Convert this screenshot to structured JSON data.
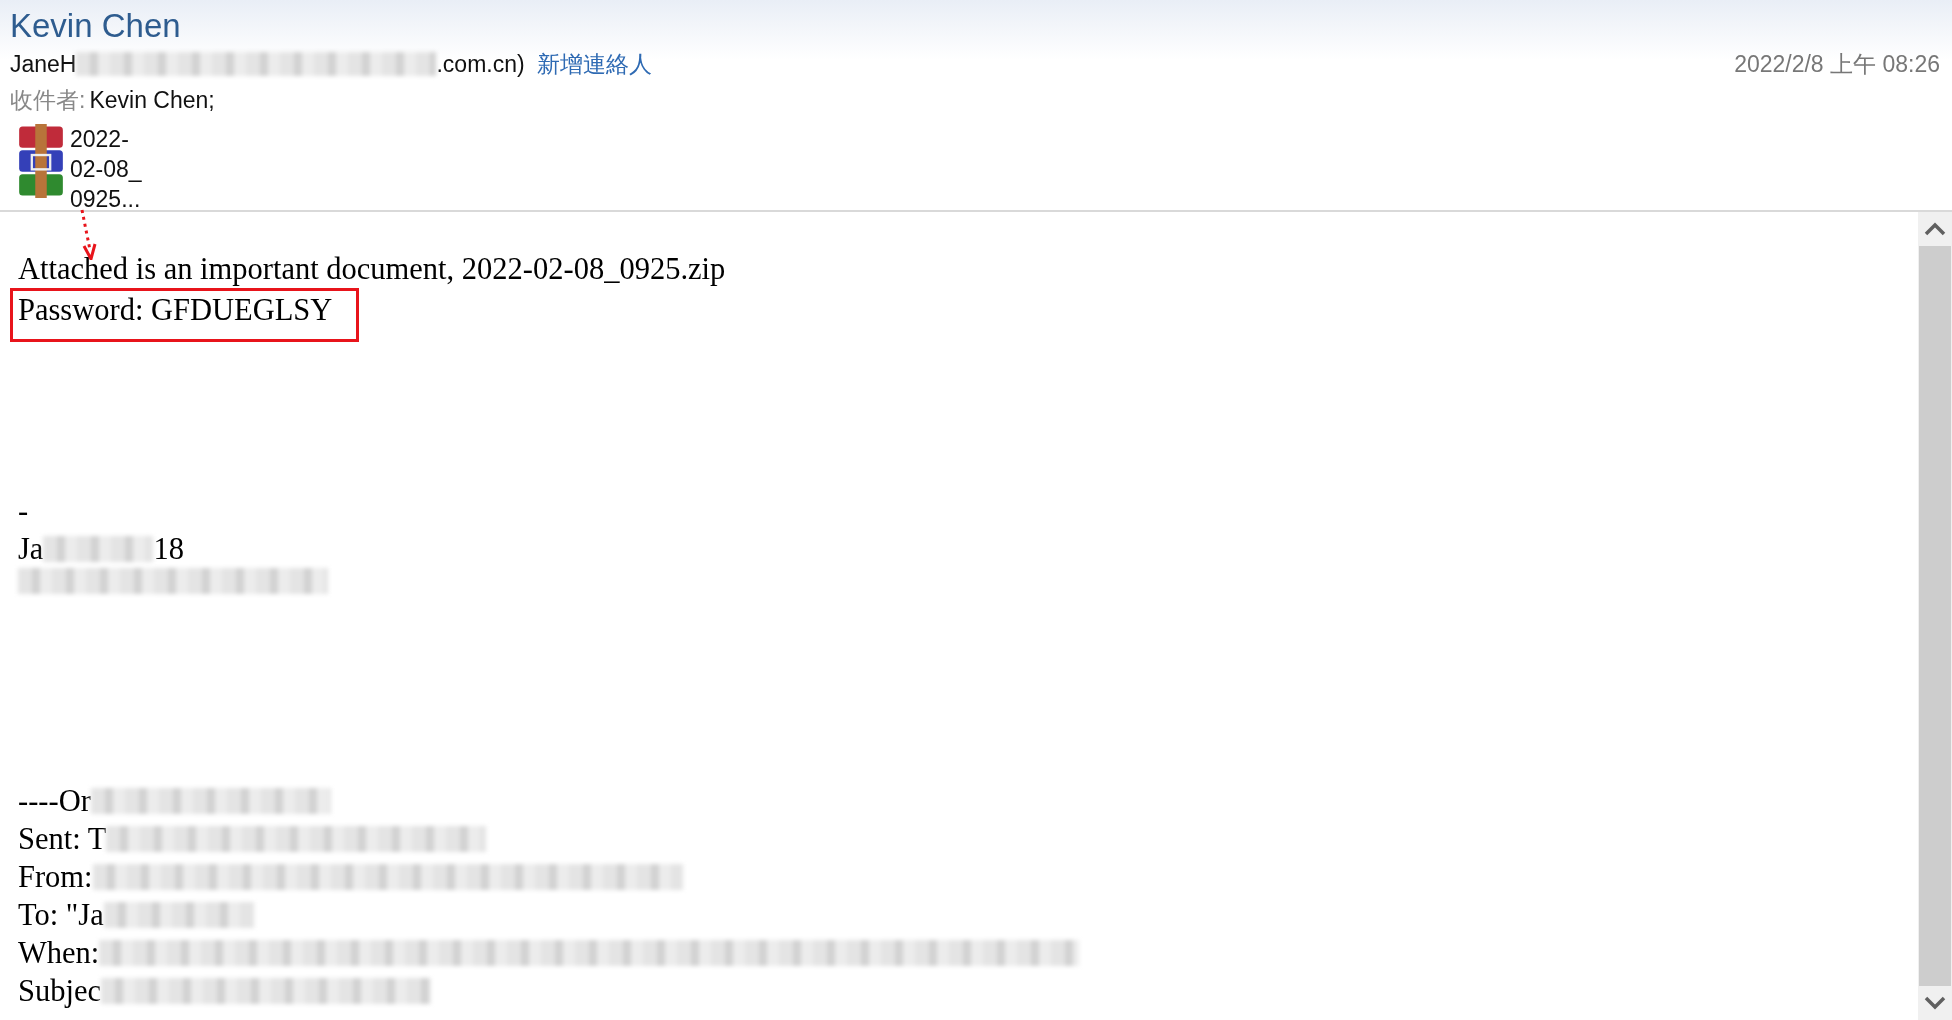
{
  "header": {
    "title": "Kevin Chen",
    "sender_start": "JaneH",
    "sender_end": ".com.cn)",
    "add_contact": "新增連絡人",
    "date": "2022/2/8 上午 08:26",
    "recipient_label": "收件者:",
    "recipient": "Kevin Chen;"
  },
  "attachment": {
    "name_lines": [
      "2022-",
      "02-08_",
      "0925..."
    ]
  },
  "body": {
    "lines": [
      {
        "kind": "text",
        "parts": [
          {
            "kind": "text",
            "text": "Attached is an important document, 2022-02-08_0925.zip"
          }
        ]
      },
      {
        "kind": "highlighted",
        "parts": [
          {
            "kind": "text",
            "text": "Password: GFDUEGLSY"
          }
        ]
      }
    ],
    "signature": [
      {
        "kind": "text",
        "parts": [
          {
            "kind": "text",
            "text": "-"
          }
        ]
      },
      {
        "kind": "text",
        "parts": [
          {
            "kind": "text",
            "text": "Ja"
          },
          {
            "kind": "redacted"
          },
          {
            "kind": "text",
            "text": "18"
          }
        ]
      },
      {
        "kind": "text",
        "parts": [
          {
            "kind": "redacted"
          }
        ]
      }
    ],
    "quoted": [
      {
        "kind": "text",
        "parts": [
          {
            "kind": "text",
            "text": "----Or"
          },
          {
            "kind": "redacted"
          }
        ]
      },
      {
        "kind": "text",
        "parts": [
          {
            "kind": "text",
            "text": "Sent: T"
          },
          {
            "kind": "redacted"
          }
        ]
      },
      {
        "kind": "text",
        "parts": [
          {
            "kind": "text",
            "text": "From:"
          },
          {
            "kind": "redacted"
          }
        ]
      },
      {
        "kind": "text",
        "parts": [
          {
            "kind": "text",
            "text": "To: \"Ja"
          },
          {
            "kind": "redacted"
          }
        ]
      },
      {
        "kind": "text",
        "parts": [
          {
            "kind": "text",
            "text": "When:"
          },
          {
            "kind": "redacted"
          }
        ]
      },
      {
        "kind": "text",
        "parts": [
          {
            "kind": "text",
            "text": "Subjec"
          },
          {
            "kind": "redacted"
          }
        ]
      }
    ]
  }
}
